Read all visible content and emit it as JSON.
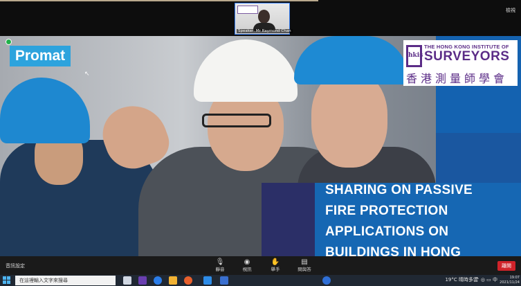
{
  "speaker": {
    "name": "Speaker: Mr Raymond Chan"
  },
  "window_controls": {
    "label": "檢視"
  },
  "slide": {
    "brand": "Promat",
    "org_line1": "THE HONG KONG INSTITUTE OF",
    "org_line2": "SURVEYORS",
    "org_line3": "香港測量師學會",
    "org_emblem": "hkis",
    "title_lines": [
      "SHARING ON PASSIVE",
      "FIRE PROTECTION",
      "APPLICATIONS ON",
      "BUILDINGS IN HONG"
    ]
  },
  "controls": {
    "audio": "音訊設定",
    "buttons": [
      {
        "icon": "mic-icon",
        "label": "靜音"
      },
      {
        "icon": "video-icon",
        "label": "視訊"
      },
      {
        "icon": "hand-icon",
        "label": "舉手"
      },
      {
        "icon": "chat-icon",
        "label": "問與答"
      }
    ],
    "end": "離開"
  },
  "taskbar": {
    "search_placeholder": "在這裡輸入文字來搜尋",
    "weather": "19°C 晴時多雲",
    "clock_time": "19:07",
    "clock_date": "2021/11/24",
    "tray": "^ ◎ ▭ 中"
  },
  "colors": {
    "accent": "#1667b3",
    "brand": "#2da3dd",
    "hkis": "#5b2c87",
    "end": "#d0232a"
  }
}
